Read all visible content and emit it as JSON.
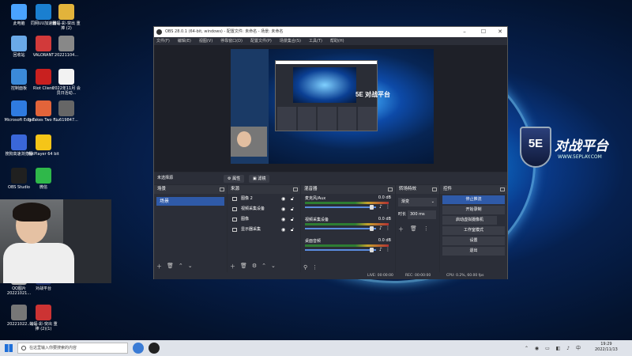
{
  "desktop": {
    "icons": [
      {
        "label": "此电脑",
        "icon": "computer-icon"
      },
      {
        "label": "同网UU加速器",
        "icon": "uu-accelerator-icon"
      },
      {
        "label": "蝙蝠-彩-突出 重捧 (2)",
        "icon": "folder-icon"
      },
      {
        "label": "回收站",
        "icon": "recycle-bin-icon"
      },
      {
        "label": "VALORANT",
        "icon": "valorant-icon"
      },
      {
        "label": "20221104...",
        "icon": "image-file-icon"
      },
      {
        "label": "控制面板",
        "icon": "control-panel-icon"
      },
      {
        "label": "Riot Client",
        "icon": "riot-client-icon"
      },
      {
        "label": "2022年11月 会员日活动...",
        "icon": "document-icon"
      },
      {
        "label": "Microsoft Edge",
        "icon": "edge-icon"
      },
      {
        "label": "It Takes Two F...",
        "icon": "it-takes-two-icon"
      },
      {
        "label": "liu619847...",
        "icon": "image-file-icon"
      },
      {
        "label": "搜狗高速浏览器",
        "icon": "sogou-browser-icon"
      },
      {
        "label": "PotPlayer 64 bit",
        "icon": "potplayer-icon"
      },
      {
        "label": "OBS Studio",
        "icon": "obs-icon"
      },
      {
        "label": "微信",
        "icon": "wechat-icon"
      },
      {
        "label": "QQ图片 20221021...",
        "icon": "image-file-icon"
      },
      {
        "label": "对战平台",
        "icon": "5e-platform-icon"
      },
      {
        "label": "20221022...",
        "icon": "image-file-icon"
      },
      {
        "label": "蝙蝠-彩-突出 重捧 (2)(1)",
        "icon": "archive-icon"
      }
    ]
  },
  "brand": {
    "badge": "5E",
    "name": "对战平台",
    "url": "WWW.5EPLAY.COM"
  },
  "obs": {
    "title": "OBS 28.0.1 (64-bit, windows) - 配置文件: 未命名 - 场景: 未命名",
    "menu": [
      "文件(F)",
      "编辑(E)",
      "视图(V)",
      "停靠窗口(D)",
      "配置文件(P)",
      "场景集合(S)",
      "工具(T)",
      "帮助(H)"
    ],
    "no_source": "未选择源",
    "tab_properties": "属性",
    "tab_filters": "滤镜",
    "preview_logo": "5E 对战平台",
    "scenes": {
      "title": "场景",
      "items": [
        "场景"
      ]
    },
    "sources": {
      "title": "来源",
      "items": [
        {
          "label": "图像 2",
          "icon": "image-source-icon"
        },
        {
          "label": "视频采集设备",
          "icon": "camera-source-icon"
        },
        {
          "label": "图像",
          "icon": "image-source-icon"
        },
        {
          "label": "显示器采集",
          "icon": "monitor-source-icon"
        }
      ]
    },
    "mixer": {
      "title": "混音器",
      "channels": [
        {
          "name": "麦克风/Aux",
          "db": "0.0 dB"
        },
        {
          "name": "视频采集设备",
          "db": "0.0 dB"
        },
        {
          "name": "桌面音频",
          "db": "0.0 dB"
        }
      ]
    },
    "transitions": {
      "title": "转场特效",
      "selected": "渐变",
      "duration_label": "时长",
      "duration": "300 ms"
    },
    "controls": {
      "title": "控件",
      "buttons": [
        "停止推流",
        "开始录制",
        "启动虚拟摄像机",
        "工作室模式",
        "设置",
        "退出"
      ]
    },
    "status": {
      "live": "LIVE: 00:00:00",
      "rec": "REC: 00:00:00",
      "cpu": "CPU: 0.2%, 60.00 fps"
    }
  },
  "taskbar": {
    "search_placeholder": "在这里输入你要搜索的内容",
    "time": "19:29",
    "date": "2022/11/13",
    "tray_icons": [
      "up-arrow-icon",
      "network-icon",
      "volume-icon",
      "ime-icon"
    ]
  },
  "colors": {
    "accent": "#2f5aa8",
    "obs_bg": "#272a33",
    "dock_bg": "#2b2e38"
  }
}
